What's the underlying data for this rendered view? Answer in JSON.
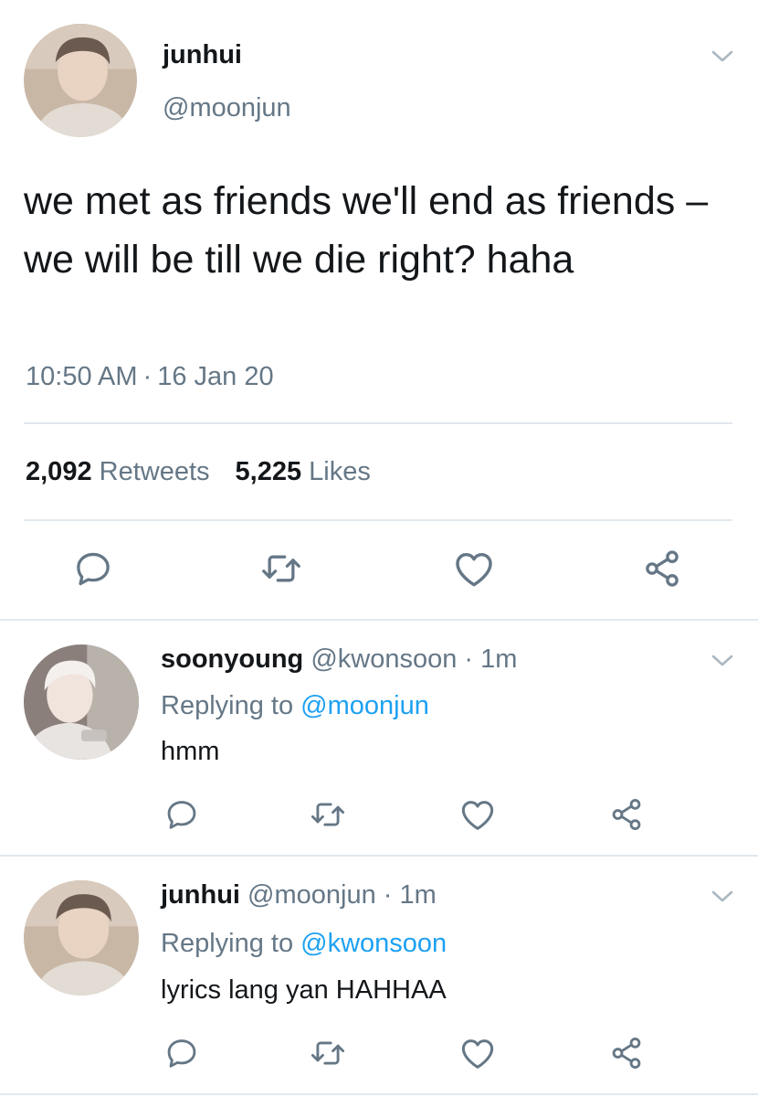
{
  "main_tweet": {
    "name": "junhui",
    "handle": "@moonjun",
    "text": "we met as friends we'll end as friends – we will be till we die right? haha",
    "time": "10:50 AM",
    "date": "16 Jan 20",
    "retweets_count": "2,092",
    "retweets_label": "Retweets",
    "likes_count": "5,225",
    "likes_label": "Likes"
  },
  "replies": [
    {
      "name": "soonyoung",
      "handle": "@kwonsoon",
      "time": "1m",
      "replying_label": "Replying to",
      "replying_to": "@moonjun",
      "text": "hmm"
    },
    {
      "name": "junhui",
      "handle": "@moonjun",
      "time": "1m",
      "replying_label": "Replying to",
      "replying_to": "@kwonsoon",
      "text": "lyrics lang yan HAHHAA"
    }
  ],
  "meta_separator": "·",
  "icons": {
    "reply": "reply-icon",
    "retweet": "retweet-icon",
    "like": "heart-icon",
    "share": "share-icon",
    "menu": "chevron-down-icon"
  },
  "colors": {
    "text": "#14171a",
    "secondary": "#657786",
    "link": "#1da1f2",
    "divider": "#e1e8ed"
  }
}
